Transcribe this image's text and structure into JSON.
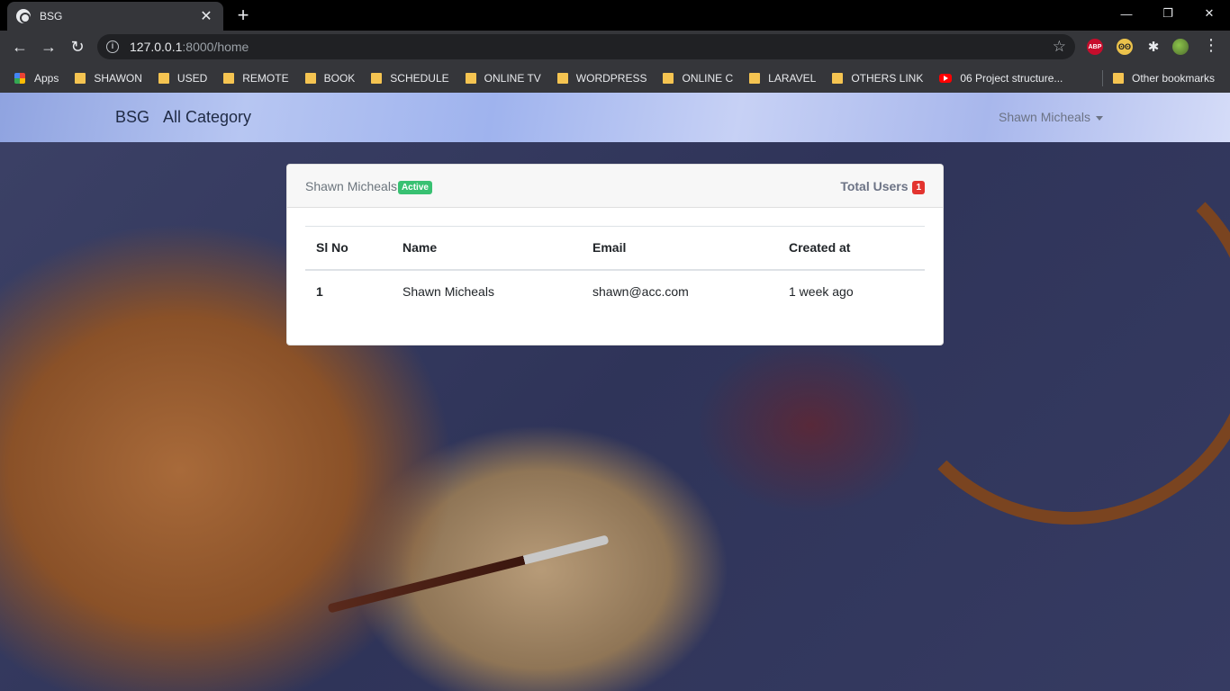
{
  "browser": {
    "tab_title": "BSG",
    "tab_close": "✕",
    "new_tab": "+",
    "url_host": "127.0.0.1",
    "url_path": ":8000/home",
    "window_controls": {
      "minimize": "—",
      "restore": "❐",
      "close": "✕"
    },
    "nav": {
      "back": "←",
      "forward": "→",
      "reload": "↻"
    },
    "extensions": {
      "abp": "ABP",
      "owl": "ʘʘ",
      "puzzle": "✱"
    },
    "bookmarks": [
      {
        "label": "Apps",
        "type": "apps"
      },
      {
        "label": "SHAWON",
        "type": "folder"
      },
      {
        "label": "USED",
        "type": "folder"
      },
      {
        "label": "REMOTE",
        "type": "folder"
      },
      {
        "label": "BOOK",
        "type": "folder"
      },
      {
        "label": "SCHEDULE",
        "type": "folder"
      },
      {
        "label": "ONLINE TV",
        "type": "folder"
      },
      {
        "label": "WORDPRESS",
        "type": "folder"
      },
      {
        "label": "ONLINE C",
        "type": "folder"
      },
      {
        "label": "LARAVEL",
        "type": "folder"
      },
      {
        "label": "OTHERS LINK",
        "type": "folder"
      },
      {
        "label": "06 Project structure...",
        "type": "youtube"
      }
    ],
    "other_bookmarks": "Other bookmarks"
  },
  "navbar": {
    "brand": "BSG",
    "link": "All Category",
    "user": "Shawn Micheals"
  },
  "card": {
    "user_name": "Shawn Micheals",
    "status_badge": "Active",
    "total_users_label": "Total Users",
    "total_users_count": "1"
  },
  "table": {
    "headers": [
      "Sl No",
      "Name",
      "Email",
      "Created at"
    ],
    "rows": [
      {
        "sl": "1",
        "name": "Shawn Micheals",
        "email": "shawn@acc.com",
        "created": "1 week ago"
      }
    ]
  },
  "colors": {
    "badge_active": "#38c172",
    "badge_count": "#e3342f"
  }
}
